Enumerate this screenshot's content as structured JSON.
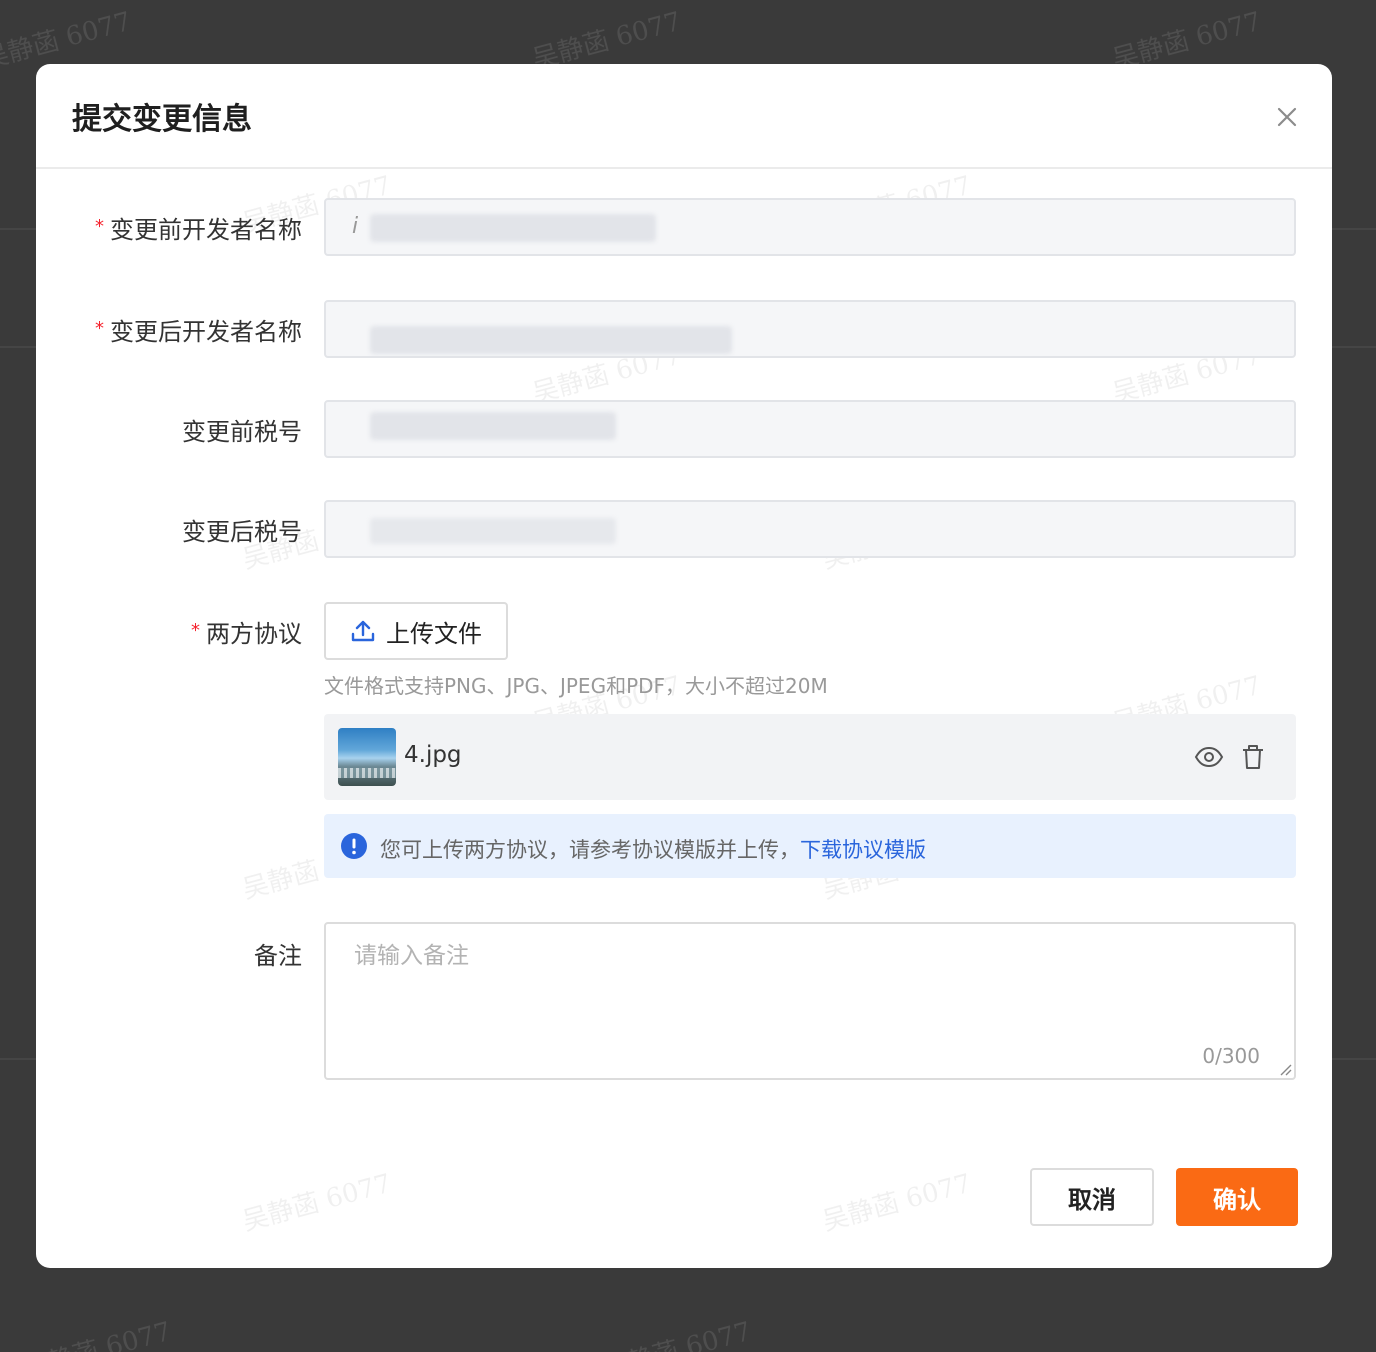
{
  "watermark": "吴静菡 6077",
  "dialog": {
    "title": "提交变更信息",
    "close_icon": "close-icon"
  },
  "form": {
    "before_developer_name": {
      "label": "变更前开发者名称",
      "required": "*",
      "value": "",
      "visible_char": "i"
    },
    "after_developer_name": {
      "label": "变更后开发者名称",
      "required": "*",
      "value": ""
    },
    "before_tax_id": {
      "label": "变更前税号",
      "value": ""
    },
    "after_tax_id": {
      "label": "变更后税号",
      "value": ""
    },
    "agreement": {
      "label": "两方协议",
      "required": "*",
      "upload_label": "上传文件",
      "upload_icon": "upload-icon",
      "hint": "文件格式支持PNG、JPG、JPEG和PDF，大小不超过20M",
      "file": {
        "name": "4.jpg",
        "preview_icon": "eye-icon",
        "delete_icon": "trash-icon"
      },
      "notice": {
        "icon": "info-icon",
        "text": "您可上传两方协议，请参考协议模版并上传，",
        "link": "下载协议模版"
      }
    },
    "remark": {
      "label": "备注",
      "placeholder": "请输入备注",
      "value": "",
      "counter": "0/300"
    }
  },
  "footer": {
    "cancel_label": "取消",
    "confirm_label": "确认"
  },
  "colors": {
    "primary": "#fa6a14",
    "link": "#2a65dc",
    "required": "#f5222d",
    "notice_bg": "#e8f1fe",
    "overlay": "#3a3a3a"
  }
}
